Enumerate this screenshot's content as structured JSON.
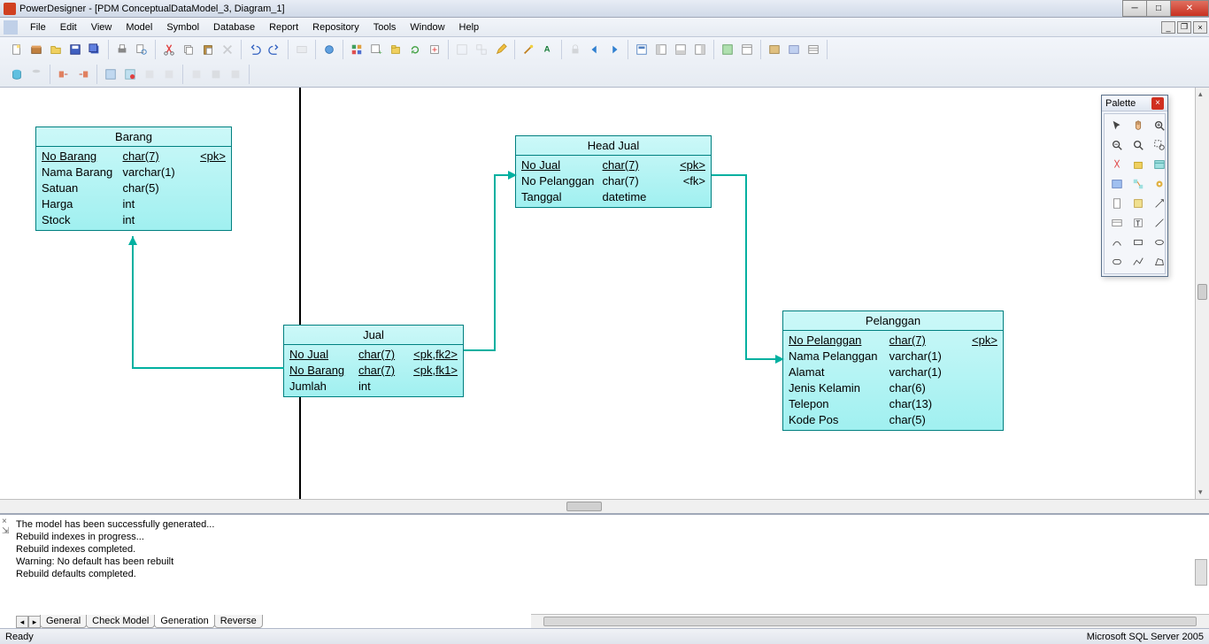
{
  "titlebar": {
    "text": "PowerDesigner - [PDM ConceptualDataModel_3, Diagram_1]"
  },
  "menu": [
    "File",
    "Edit",
    "View",
    "Model",
    "Symbol",
    "Database",
    "Report",
    "Repository",
    "Tools",
    "Window",
    "Help"
  ],
  "palette": {
    "title": "Palette"
  },
  "tables": {
    "barang": {
      "title": "Barang",
      "rows": [
        {
          "name": "No Barang",
          "type": "char(7)",
          "key": "<pk>",
          "u": true
        },
        {
          "name": "Nama Barang",
          "type": "varchar(1)",
          "key": ""
        },
        {
          "name": "Satuan",
          "type": "char(5)",
          "key": ""
        },
        {
          "name": "Harga",
          "type": "int",
          "key": ""
        },
        {
          "name": "Stock",
          "type": "int",
          "key": ""
        }
      ]
    },
    "headjual": {
      "title": "Head Jual",
      "rows": [
        {
          "name": "No Jual",
          "type": "char(7)",
          "key": "<pk>",
          "u": true
        },
        {
          "name": "No Pelanggan",
          "type": "char(7)",
          "key": "<fk>"
        },
        {
          "name": "Tanggal",
          "type": "datetime",
          "key": ""
        }
      ]
    },
    "jual": {
      "title": "Jual",
      "rows": [
        {
          "name": "No Jual",
          "type": "char(7)",
          "key": "<pk,fk2>",
          "u": true
        },
        {
          "name": "No Barang",
          "type": "char(7)",
          "key": "<pk,fk1>",
          "u": true
        },
        {
          "name": "Jumlah",
          "type": "int",
          "key": ""
        }
      ]
    },
    "pelanggan": {
      "title": "Pelanggan",
      "rows": [
        {
          "name": "No Pelanggan",
          "type": "char(7)",
          "key": "<pk>",
          "u": true
        },
        {
          "name": "Nama Pelanggan",
          "type": "varchar(1)",
          "key": ""
        },
        {
          "name": "Alamat",
          "type": "varchar(1)",
          "key": ""
        },
        {
          "name": "Jenis Kelamin",
          "type": "char(6)",
          "key": ""
        },
        {
          "name": "Telepon",
          "type": "char(13)",
          "key": ""
        },
        {
          "name": "Kode Pos",
          "type": "char(5)",
          "key": ""
        }
      ]
    }
  },
  "output": {
    "lines": [
      "The model has been successfully generated...",
      "Rebuild indexes in progress...",
      "Rebuild indexes completed.",
      "",
      "Warning: No default has been rebuilt",
      "Rebuild defaults completed."
    ],
    "tabs": [
      "General",
      "Check Model",
      "Generation",
      "Reverse"
    ]
  },
  "status": {
    "left": "Ready",
    "right": "Microsoft SQL Server 2005"
  }
}
